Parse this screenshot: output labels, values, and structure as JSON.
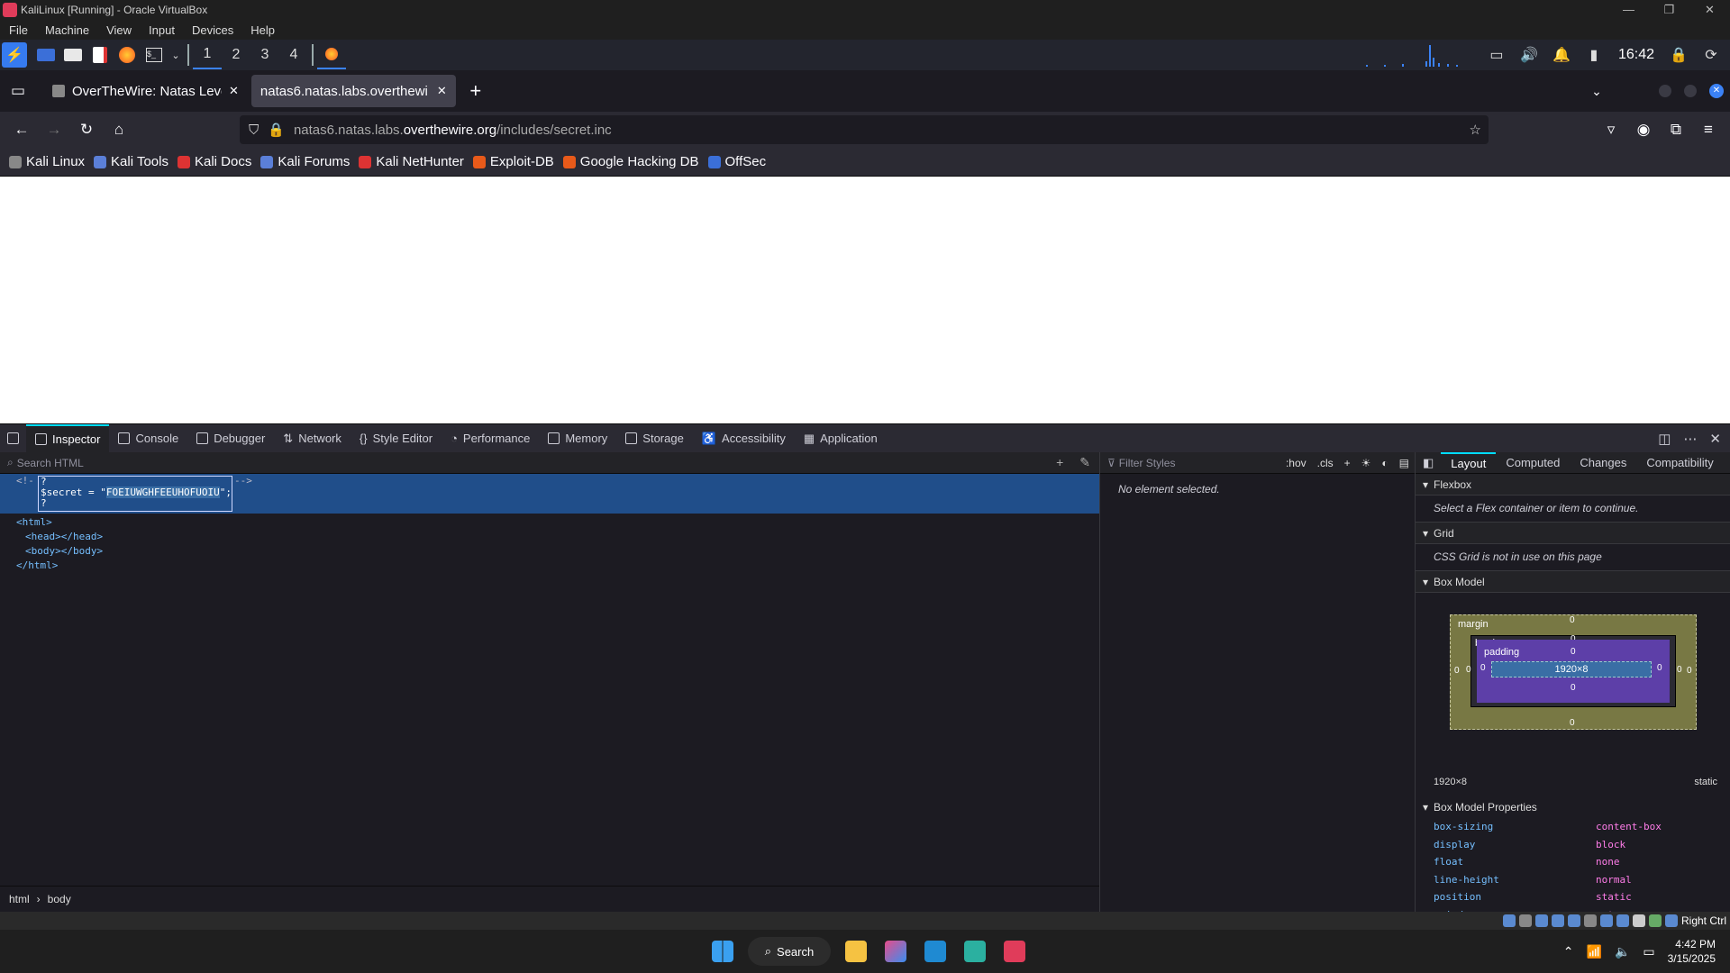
{
  "vbox": {
    "title": "KaliLinux [Running] - Oracle VirtualBox",
    "menu": [
      "File",
      "Machine",
      "View",
      "Input",
      "Devices",
      "Help"
    ]
  },
  "kali": {
    "workspaces": [
      "1",
      "2",
      "3",
      "4"
    ],
    "clock": "16:42"
  },
  "firefox": {
    "tabs": [
      {
        "title": "OverTheWire: Natas Leve"
      },
      {
        "title": "natas6.natas.labs.overthewi"
      }
    ],
    "url": {
      "prefix": "natas6.natas.labs.",
      "host": "overthewire.org",
      "path": "/includes/secret.inc"
    },
    "bookmarks": [
      "Kali Linux",
      "Kali Tools",
      "Kali Docs",
      "Kali Forums",
      "Kali NetHunter",
      "Exploit-DB",
      "Google Hacking DB",
      "OffSec"
    ]
  },
  "devtools": {
    "tabs": [
      "Inspector",
      "Console",
      "Debugger",
      "Network",
      "Style Editor",
      "Performance",
      "Memory",
      "Storage",
      "Accessibility",
      "Application"
    ],
    "search_placeholder": "Search HTML",
    "markup": {
      "comment_open": "<!-",
      "comment_close": "-->",
      "line_q1": "?",
      "secret_pre": "$secret = \"",
      "secret_value": "FOEIUWGHFEEUHOFUOIU",
      "secret_post": "\";",
      "line_q2": "?",
      "html_open": "<html>",
      "head": "<head></head>",
      "body": "<body></body>",
      "html_close": "</html>"
    },
    "breadcrumbs": [
      "html",
      "body"
    ],
    "styles": {
      "filter_placeholder": "Filter Styles",
      "hov": ":hov",
      "cls": ".cls",
      "empty": "No element selected."
    },
    "layout": {
      "tabs": [
        "Layout",
        "Computed",
        "Changes",
        "Compatibility"
      ],
      "flexbox": "Flexbox",
      "flexbox_msg": "Select a Flex container or item to continue.",
      "grid": "Grid",
      "grid_msg": "CSS Grid is not in use on this page",
      "boxmodel": "Box Model",
      "bm_margin": "margin",
      "bm_border": "border",
      "bm_padding": "padding",
      "bm_content": "1920×8",
      "bm_zero": "0",
      "size": "1920×8",
      "position": "static",
      "props_title": "Box Model Properties",
      "props": [
        {
          "k": "box-sizing",
          "v": "content-box"
        },
        {
          "k": "display",
          "v": "block"
        },
        {
          "k": "float",
          "v": "none"
        },
        {
          "k": "line-height",
          "v": "normal"
        },
        {
          "k": "position",
          "v": "static"
        },
        {
          "k": "z-index",
          "v": "auto"
        }
      ]
    }
  },
  "vb_status": {
    "host_key": "Right Ctrl"
  },
  "taskbar": {
    "search": "Search",
    "time": "4:42 PM",
    "date": "3/15/2025"
  },
  "colors": {
    "accent": "#3b82f6",
    "selection": "#204e8a"
  }
}
